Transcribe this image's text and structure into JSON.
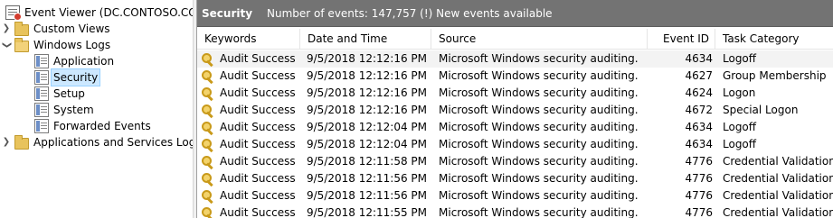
{
  "tree": {
    "root": "Event Viewer (DC.CONTOSO.COM)",
    "custom_views": "Custom Views",
    "windows_logs": "Windows Logs",
    "application": "Application",
    "security": "Security",
    "setup": "Setup",
    "system": "System",
    "forwarded_events": "Forwarded Events",
    "apps_services": "Applications and Services Logs"
  },
  "pane": {
    "title": "Security",
    "info": "Number of events: 147,757 (!) New events available"
  },
  "columns": {
    "keywords": "Keywords",
    "date": "Date and Time",
    "source": "Source",
    "event_id": "Event ID",
    "task": "Task Category"
  },
  "events": [
    {
      "keywords": "Audit Success",
      "date": "9/5/2018 12:12:16 PM",
      "source": "Microsoft Windows security auditing.",
      "event_id": "4634",
      "task": "Logoff"
    },
    {
      "keywords": "Audit Success",
      "date": "9/5/2018 12:12:16 PM",
      "source": "Microsoft Windows security auditing.",
      "event_id": "4627",
      "task": "Group Membership"
    },
    {
      "keywords": "Audit Success",
      "date": "9/5/2018 12:12:16 PM",
      "source": "Microsoft Windows security auditing.",
      "event_id": "4624",
      "task": "Logon"
    },
    {
      "keywords": "Audit Success",
      "date": "9/5/2018 12:12:16 PM",
      "source": "Microsoft Windows security auditing.",
      "event_id": "4672",
      "task": "Special Logon"
    },
    {
      "keywords": "Audit Success",
      "date": "9/5/2018 12:12:04 PM",
      "source": "Microsoft Windows security auditing.",
      "event_id": "4634",
      "task": "Logoff"
    },
    {
      "keywords": "Audit Success",
      "date": "9/5/2018 12:12:04 PM",
      "source": "Microsoft Windows security auditing.",
      "event_id": "4634",
      "task": "Logoff"
    },
    {
      "keywords": "Audit Success",
      "date": "9/5/2018 12:11:58 PM",
      "source": "Microsoft Windows security auditing.",
      "event_id": "4776",
      "task": "Credential Validation"
    },
    {
      "keywords": "Audit Success",
      "date": "9/5/2018 12:11:56 PM",
      "source": "Microsoft Windows security auditing.",
      "event_id": "4776",
      "task": "Credential Validation"
    },
    {
      "keywords": "Audit Success",
      "date": "9/5/2018 12:11:56 PM",
      "source": "Microsoft Windows security auditing.",
      "event_id": "4776",
      "task": "Credential Validation"
    },
    {
      "keywords": "Audit Success",
      "date": "9/5/2018 12:11:55 PM",
      "source": "Microsoft Windows security auditing.",
      "event_id": "4776",
      "task": "Credential Validation"
    }
  ],
  "icons": {
    "root": "event-viewer-icon",
    "folder": "folder-icon",
    "log": "log-icon",
    "keyword": "key-icon"
  }
}
